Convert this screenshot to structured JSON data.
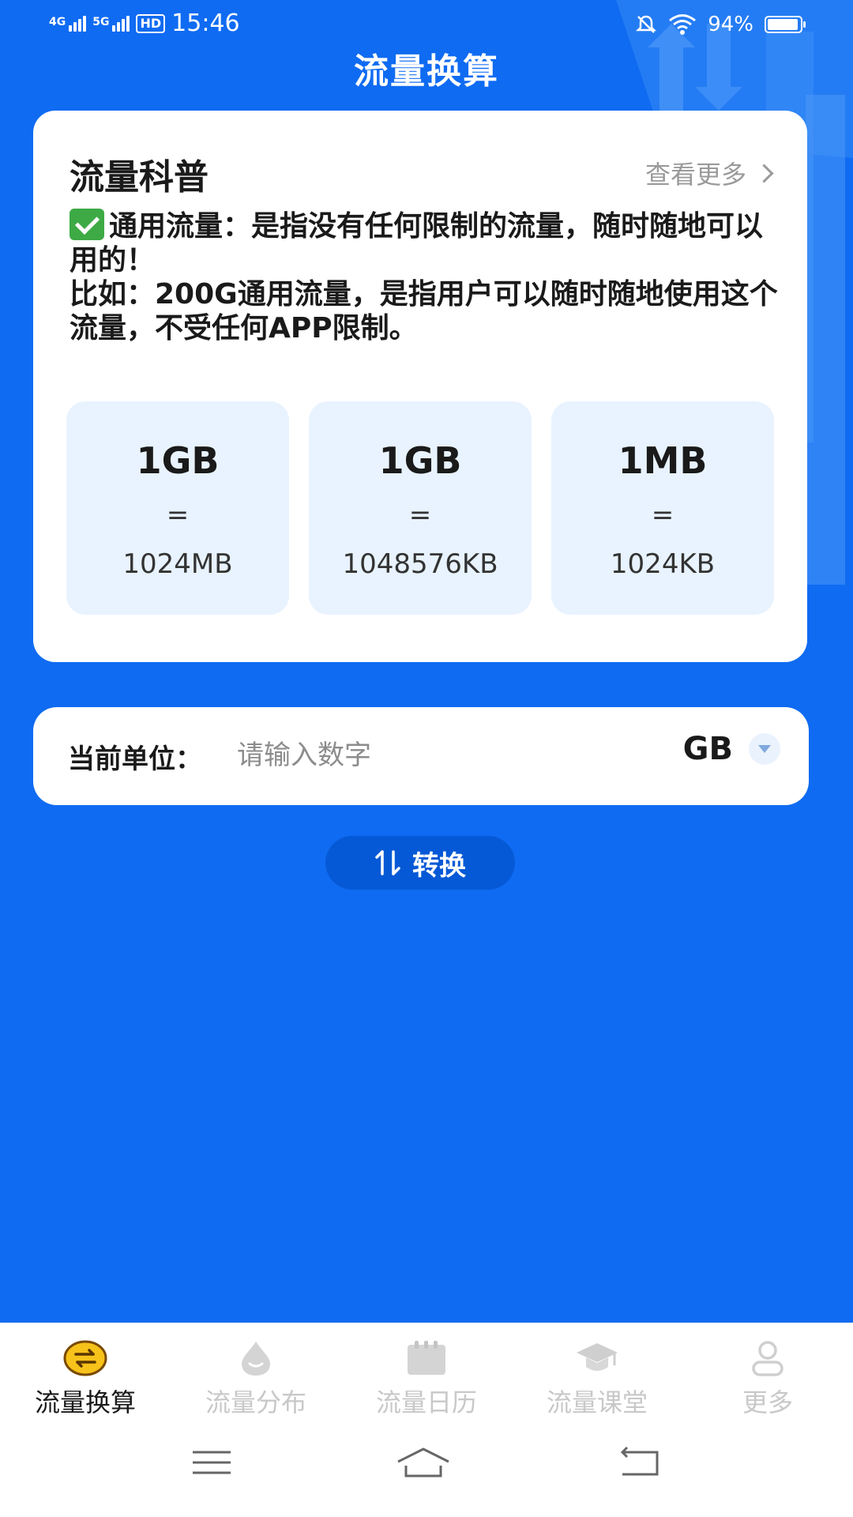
{
  "status_bar": {
    "net1": "4G",
    "net2": "5G",
    "hd": "HD",
    "time": "15:46",
    "battery": "94%",
    "battery_level": 0.94
  },
  "header": {
    "title": "流量换算"
  },
  "info_card": {
    "title": "流量科普",
    "more_label": "查看更多",
    "line1": "通用流量：是指没有任何限制的流量，随时随地可以用的！",
    "line2": "比如：200G通用流量，是指用户可以随时随地使用这个流量，不受任何APP限制。",
    "conversions": [
      {
        "from": "1GB",
        "eq": "=",
        "to": "1024MB"
      },
      {
        "from": "1GB",
        "eq": "=",
        "to": "1048576KB"
      },
      {
        "from": "1MB",
        "eq": "=",
        "to": "1024KB"
      }
    ]
  },
  "unit_row": {
    "label": "当前单位：",
    "placeholder": "请输入数字",
    "unit": "GB"
  },
  "convert_button": {
    "label": "转换"
  },
  "bottom_nav": {
    "items": [
      {
        "label": "流量换算",
        "active": true
      },
      {
        "label": "流量分布",
        "active": false
      },
      {
        "label": "流量日历",
        "active": false
      },
      {
        "label": "流量课堂",
        "active": false
      },
      {
        "label": "更多",
        "active": false
      }
    ]
  },
  "colors": {
    "background": "#0F6BF2",
    "card": "#FFFFFF",
    "conv_box": "#E8F3FF",
    "button": "#0659D6",
    "active_icon": "#F7C21A",
    "inactive": "#C8C8C8"
  }
}
